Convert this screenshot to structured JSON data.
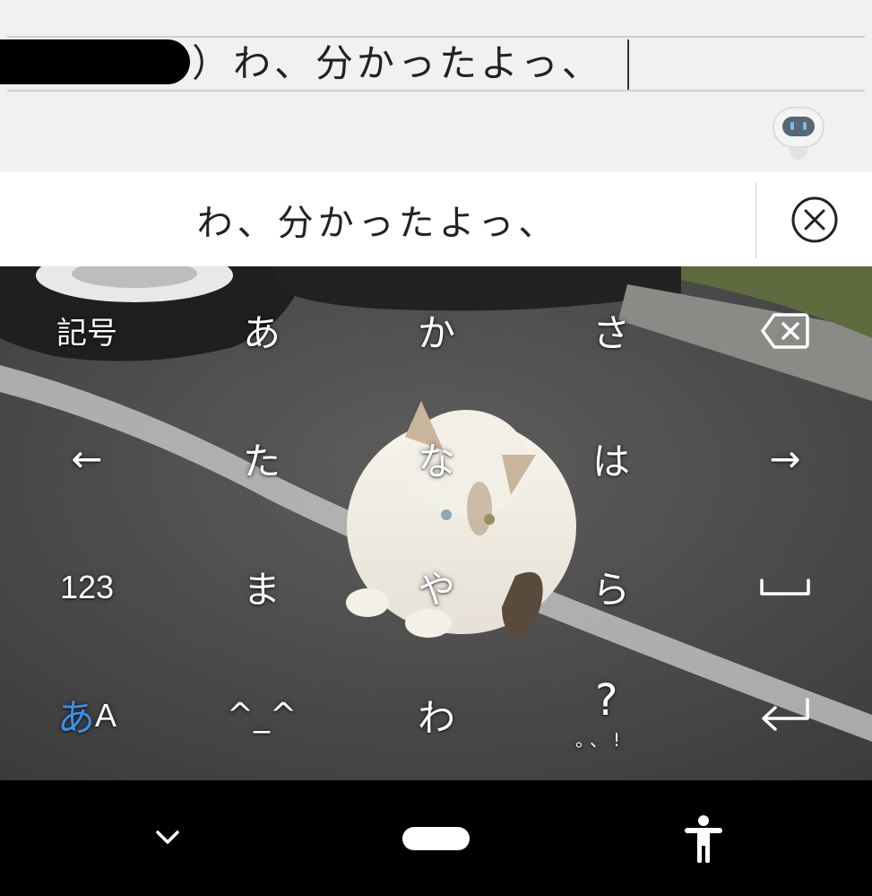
{
  "compose": {
    "text": "）わ、分かったよっ、",
    "assistant_icon": "robot-assistant-icon"
  },
  "candidate": {
    "text": "わ、分かったよっ、",
    "close_icon": "close-circle-icon"
  },
  "keyboard": {
    "rows": [
      [
        "記号",
        "あ",
        "か",
        "さ",
        "backspace-icon"
      ],
      [
        "←",
        "た",
        "な",
        "は",
        "→"
      ],
      [
        "123",
        "ま",
        "や",
        "ら",
        "space-icon"
      ],
      [
        "あA",
        "^_^",
        "わ",
        "？。、！",
        "enter-icon"
      ]
    ],
    "symbols": "記号",
    "a": "あ",
    "ka": "か",
    "sa": "さ",
    "left": "←",
    "ta": "た",
    "na": "な",
    "ha": "は",
    "right": "→",
    "num": "123",
    "ma": "ま",
    "ya": "や",
    "ra": "ら",
    "mode_kana": "あ",
    "mode_alpha": "A",
    "emoticon": "^_^",
    "wa": "わ",
    "punct_q": "?",
    "punct_rest": "。、!",
    "accent_color": "#3c8fe6"
  },
  "navbar": {
    "back_icon": "chevron-down-icon",
    "home_icon": "home-pill-icon",
    "accessibility_icon": "accessibility-icon"
  }
}
